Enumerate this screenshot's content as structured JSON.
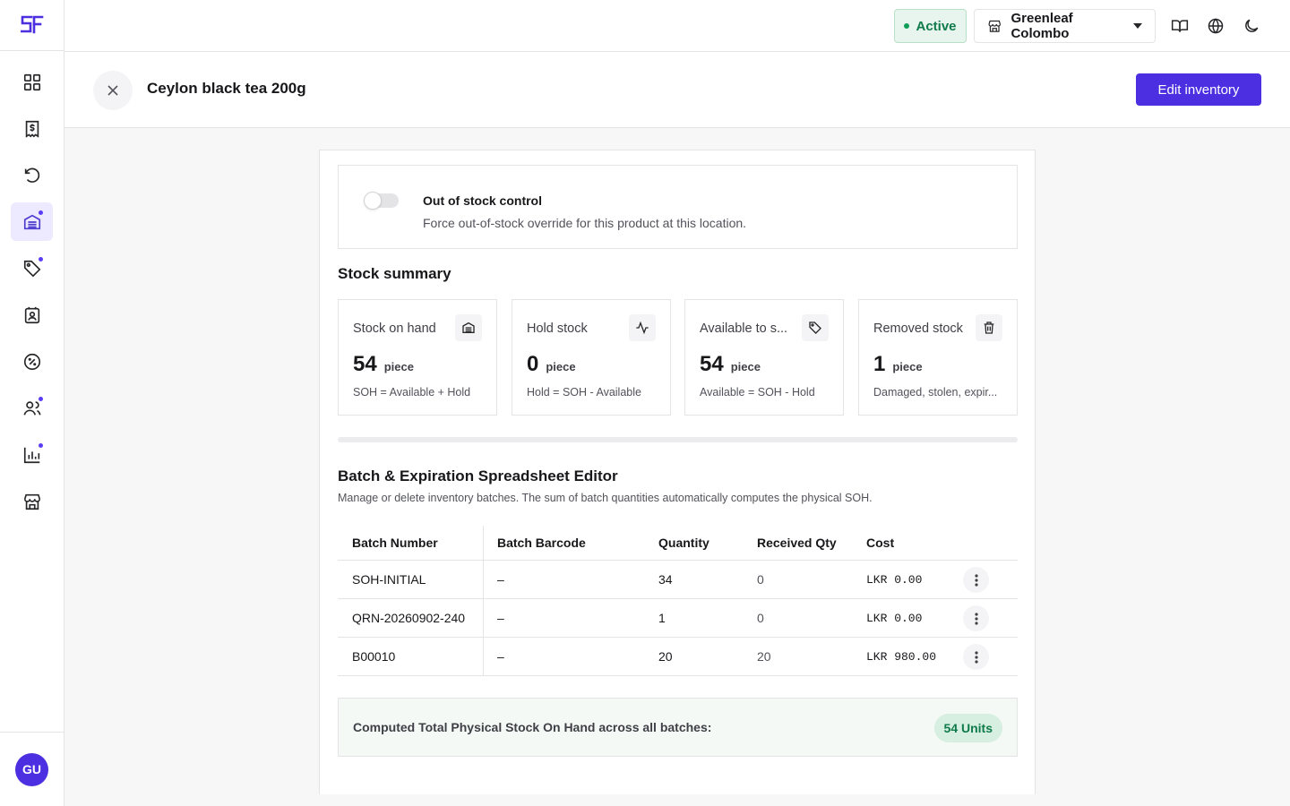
{
  "app": {
    "logo_alt": "SF"
  },
  "user": {
    "initials": "GU"
  },
  "topbar": {
    "status": "Active",
    "store": "Greenleaf Colombo"
  },
  "header": {
    "title": "Ceylon black tea 200g",
    "edit_label": "Edit inventory"
  },
  "out_of_stock": {
    "title": "Out of stock control",
    "description": "Force out-of-stock override for this product at this location.",
    "enabled": false
  },
  "stock_summary": {
    "title": "Stock summary",
    "cards": [
      {
        "label": "Stock on hand",
        "value": "54",
        "unit": "piece",
        "note": "SOH = Available + Hold",
        "icon": "warehouse-icon"
      },
      {
        "label": "Hold stock",
        "value": "0",
        "unit": "piece",
        "note": "Hold = SOH - Available",
        "icon": "activity-icon"
      },
      {
        "label": "Available to s...",
        "value": "54",
        "unit": "piece",
        "note": "Available = SOH - Hold",
        "icon": "tag-icon"
      },
      {
        "label": "Removed stock",
        "value": "1",
        "unit": "piece",
        "note": "Damaged, stolen, expir...",
        "icon": "trash-icon"
      }
    ]
  },
  "batches": {
    "title": "Batch & Expiration Spreadsheet Editor",
    "description": "Manage or delete inventory batches. The sum of batch quantities automatically computes the physical SOH.",
    "columns": [
      "Batch Number",
      "Batch Barcode",
      "Quantity",
      "Received Qty",
      "Cost"
    ],
    "rows": [
      {
        "batch": "SOH-INITIAL",
        "barcode": "–",
        "quantity": "34",
        "received": "0",
        "cost": "LKR 0.00"
      },
      {
        "batch": "QRN-20260902-240",
        "barcode": "–",
        "quantity": "1",
        "received": "0",
        "cost": "LKR 0.00"
      },
      {
        "batch": "B00010",
        "barcode": "–",
        "quantity": "20",
        "received": "20",
        "cost": "LKR 980.00"
      }
    ],
    "total_label": "Computed Total Physical Stock On Hand across all batches:",
    "total_value": "54 Units"
  },
  "colors": {
    "accent": "#4c2fe0",
    "success": "#0f7a4a"
  }
}
